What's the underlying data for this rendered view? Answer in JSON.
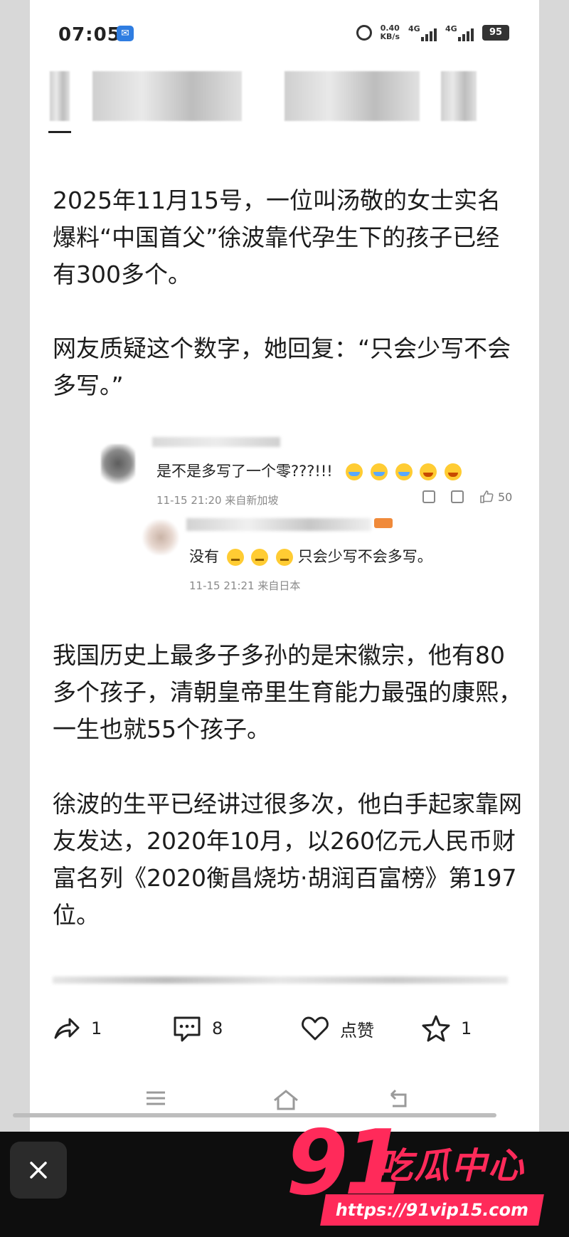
{
  "status_bar": {
    "time": "07:05",
    "net_speed": "0.40",
    "net_speed_unit": "KB/s",
    "network_1": "4G",
    "network_2": "4G",
    "battery": "95"
  },
  "article": {
    "dash": "—",
    "paragraphs": [
      "2025年11月15号，一位叫汤敬的女士实名爆料“中国首父”徐波靠代孕生下的孩子已经有300多个。",
      "网友质疑这个数字，她回复：“只会少写不会多写。”",
      "我国历史上最多子多孙的是宋徽宗，他有80多个孩子，清朝皇帝里生育能力最强的康熙，一生也就55个孩子。",
      "徐波的生平已经讲过很多次，他白手起家靠网友发达，2020年10月，以260亿元人民币财富名列《2020衡昌烧坊·胡润百富榜》第197位。"
    ]
  },
  "comments": [
    {
      "text": "是不是多写了一个零???!!!",
      "meta": "11-15 21:20 来自新加坡",
      "likes": "50"
    },
    {
      "text_prefix": "没有",
      "text": "只会少写不会多写。",
      "meta": "11-15 21:21 来自日本"
    }
  ],
  "action_bar": {
    "share_count": "1",
    "comment_count": "8",
    "like_label": "点赞",
    "favorite_count": "1"
  },
  "overlay": {
    "logo_number": "91",
    "logo_text": "吃瓜中心",
    "logo_url": "https://91vip15.com"
  },
  "colors": {
    "brand": "#ff2a5a",
    "app_badge": "#2f7de1"
  }
}
